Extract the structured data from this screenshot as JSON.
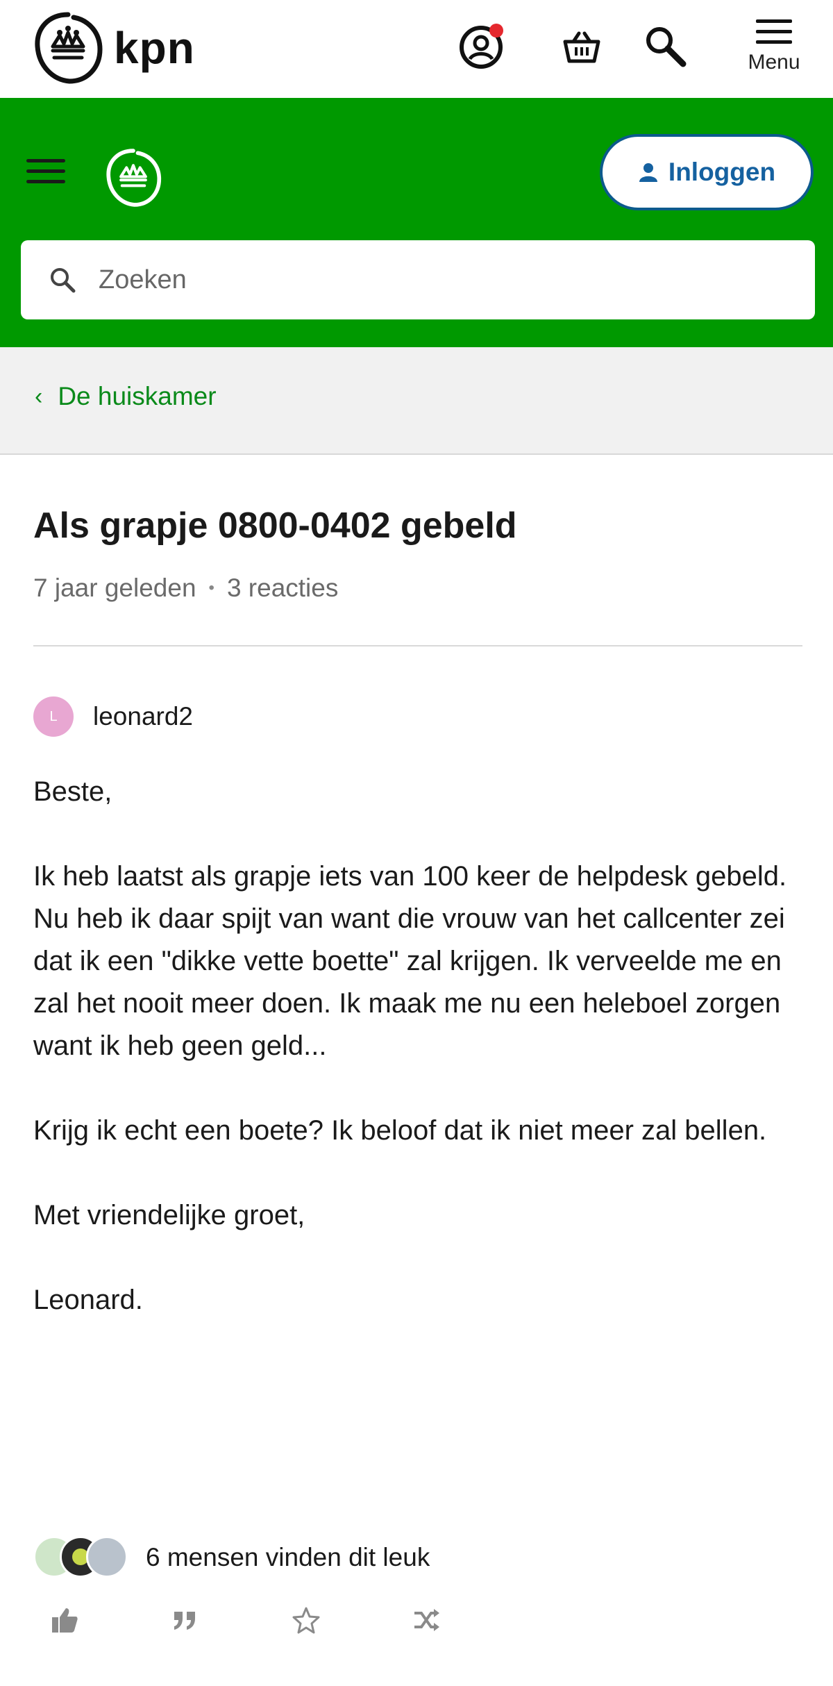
{
  "topbar": {
    "logo_text": "kpn",
    "menu_label": "Menu",
    "icons": [
      "account-icon",
      "basket-icon",
      "search-icon",
      "menu-icon"
    ]
  },
  "header": {
    "login_label": "Inloggen",
    "search_placeholder": "Zoeken"
  },
  "breadcrumb": {
    "label": "De huiskamer"
  },
  "post": {
    "title": "Als grapje 0800-0402 gebeld",
    "age": "7 jaar geleden",
    "separator": "•",
    "replies": "3 reacties",
    "author_initial": "L",
    "author": "leonard2",
    "paragraphs": [
      "Beste,",
      "Ik heb laatst als grapje iets van 100 keer de helpdesk gebeld. Nu heb ik daar spijt van want die vrouw van het callcenter zei dat ik een \"dikke vette boette\" zal krijgen. Ik verveelde me en zal het nooit meer doen. Ik maak me nu een heleboel zorgen want ik heb geen geld...",
      "Krijg ik echt een boete? Ik beloof dat ik niet meer zal bellen.",
      "Met vriendelijke groet,",
      "Leonard."
    ],
    "likes_text": "6 mensen vinden dit leuk"
  },
  "actions": [
    "thumbs-up-icon",
    "quote-icon",
    "star-icon",
    "shuffle-icon"
  ],
  "colors": {
    "brand_green": "#009900",
    "link_green": "#0a8a1a",
    "login_blue": "#1561a0",
    "notification_red": "#e5282e"
  }
}
